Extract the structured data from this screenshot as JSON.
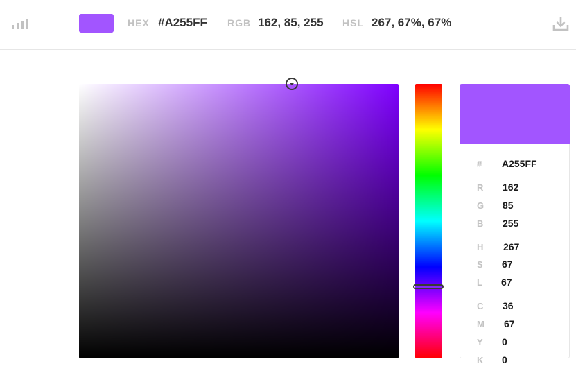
{
  "toolbar": {
    "hex_label": "HEX",
    "hex_value": "#A255FF",
    "rgb_label": "RGB",
    "rgb_value": "162, 85, 255",
    "hsl_label": "HSL",
    "hsl_value": "267, 67%, 67%",
    "icons": {
      "left": "bar-chart-icon",
      "right": "download-icon"
    }
  },
  "colors": {
    "current": "#A255FF",
    "picker_hue": "#7F00FF",
    "accent_dark": "#3A3A3A"
  },
  "picker": {
    "saturation_brightness_hue": 270,
    "hue_slider_value": 267
  },
  "info": {
    "hex": {
      "label": "#",
      "value": "A255FF"
    },
    "r": {
      "label": "R",
      "value": "162"
    },
    "g": {
      "label": "G",
      "value": "85"
    },
    "b": {
      "label": "B",
      "value": "255"
    },
    "h": {
      "label": "H",
      "value": "267"
    },
    "s": {
      "label": "S",
      "value": "67"
    },
    "l": {
      "label": "L",
      "value": "67"
    },
    "c": {
      "label": "C",
      "value": "36"
    },
    "m": {
      "label": "M",
      "value": "67"
    },
    "y": {
      "label": "Y",
      "value": "0"
    },
    "k": {
      "label": "K",
      "value": "0"
    }
  }
}
